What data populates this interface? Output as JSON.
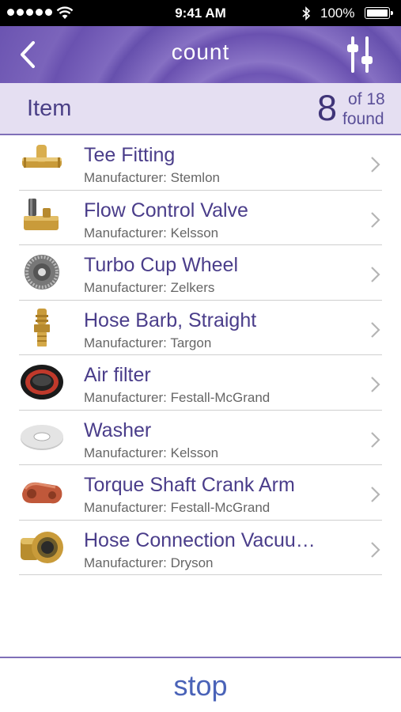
{
  "status_bar": {
    "time": "9:41 AM",
    "battery_text": "100%",
    "battery_level": 1.0
  },
  "nav": {
    "title": "count"
  },
  "header": {
    "label": "Item",
    "count": "8",
    "of_text": "of 18",
    "found_text": "found"
  },
  "items": [
    {
      "name": "Tee Fitting",
      "manufacturer_prefix": "Manufacturer:",
      "manufacturer": "Stemlon",
      "icon": "tee-fitting-icon"
    },
    {
      "name": "Flow Control Valve",
      "manufacturer_prefix": "Manufacturer:",
      "manufacturer": "Kelsson",
      "icon": "flow-control-valve-icon"
    },
    {
      "name": "Turbo Cup Wheel",
      "manufacturer_prefix": "Manufacturer:",
      "manufacturer": "Zelkers",
      "icon": "turbo-cup-wheel-icon"
    },
    {
      "name": "Hose Barb, Straight",
      "manufacturer_prefix": "Manufacturer:",
      "manufacturer": "Targon",
      "icon": "hose-barb-icon"
    },
    {
      "name": "Air filter",
      "manufacturer_prefix": "Manufacturer:",
      "manufacturer": "Festall-McGrand",
      "icon": "air-filter-icon"
    },
    {
      "name": "Washer",
      "manufacturer_prefix": "Manufacturer:",
      "manufacturer": "Kelsson",
      "icon": "washer-icon"
    },
    {
      "name": "Torque Shaft Crank Arm",
      "manufacturer_prefix": "Manufacturer:",
      "manufacturer": "Festall-McGrand",
      "icon": "crank-arm-icon"
    },
    {
      "name": "Hose Connection Vacuu…",
      "manufacturer_prefix": "Manufacturer:",
      "manufacturer": "Dryson",
      "icon": "hose-connection-icon"
    }
  ],
  "footer": {
    "stop_label": "stop"
  },
  "colors": {
    "accent": "#6b54b1",
    "header_bg": "#e5dff2",
    "title_text": "#4a3d8a",
    "stop_text": "#4a63b8"
  }
}
